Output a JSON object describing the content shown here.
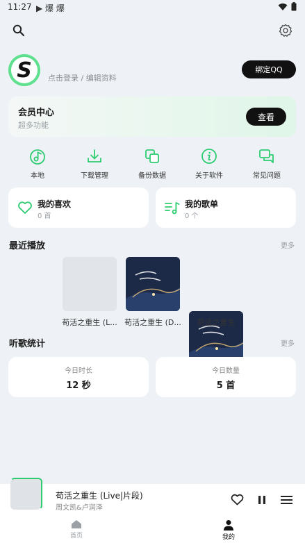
{
  "status_bar": {
    "time": "11:27",
    "notifications": "▶ 爆 爆",
    "wifi_icon": "wifi-icon",
    "battery_icon": "battery-icon"
  },
  "header": {
    "search_icon": "search-icon",
    "settings_icon": "settings-icon"
  },
  "profile": {
    "avatar_letter": "S",
    "login_text": "点击登录 / 编辑资料",
    "bind_button": "绑定QQ"
  },
  "member": {
    "title": "会员中心",
    "subtitle": "超多功能",
    "button": "查看"
  },
  "quick_actions": [
    {
      "label": "本地",
      "icon": "music-note-icon"
    },
    {
      "label": "下载管理",
      "icon": "download-icon"
    },
    {
      "label": "备份数据",
      "icon": "copy-icon"
    },
    {
      "label": "关于软件",
      "icon": "info-icon"
    },
    {
      "label": "常见问题",
      "icon": "chat-icon"
    }
  ],
  "library": {
    "favorites": {
      "title": "我的喜欢",
      "count": "0 首"
    },
    "playlists": {
      "title": "我的歌单",
      "count": "0 个"
    }
  },
  "recent": {
    "title": "最近播放",
    "more": "更多",
    "items": [
      {
        "label": "苟活之重生 (L..."
      },
      {
        "label": "苟活之重生 (D..."
      },
      {
        "label": "苟活之重生"
      }
    ]
  },
  "stats": {
    "title": "听歌统计",
    "more": "更多",
    "duration_label": "今日时长",
    "duration_value": "12 秒",
    "count_label": "今日数量",
    "count_value": "5 首"
  },
  "player": {
    "title": "苟活之重生 (Live|片段)",
    "artist": "周文凯&卢润泽"
  },
  "nav": {
    "home": "首页",
    "mine": "我的"
  },
  "colors": {
    "accent": "#2ecc71",
    "background": "#eef2f6",
    "dark_button": "#111111"
  }
}
